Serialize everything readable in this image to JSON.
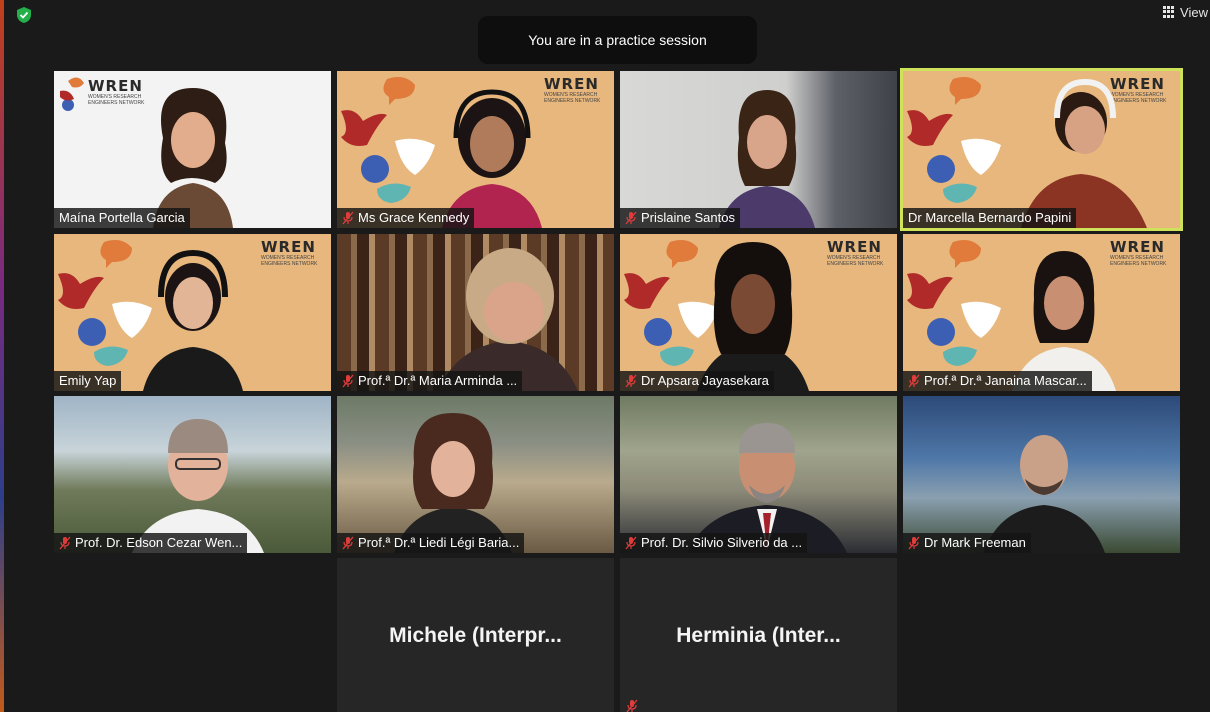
{
  "header": {
    "security_icon": "shield-check-icon",
    "view_label": "View",
    "banner_text": "You are in a practice session"
  },
  "colors": {
    "background": "#1a1a1a",
    "active_speaker_border": "#cfe35a",
    "wren_background": "#e7b77d",
    "muted_icon": "#e03c3c"
  },
  "wren": {
    "word": "WREN",
    "tagline": "WOMEN'S RESEARCH ENGINEERS NETWORK"
  },
  "participants": [
    {
      "name": "Maína Portella Garcia",
      "muted": false
    },
    {
      "name": "Ms Grace Kennedy",
      "muted": true
    },
    {
      "name": "Prislaine Santos",
      "muted": true
    },
    {
      "name": "Dr Marcella Bernardo Papini",
      "muted": false,
      "active_speaker": true
    },
    {
      "name": "Emily Yap",
      "muted": false
    },
    {
      "name": "Prof.ª Dr.ª Maria Arminda ...",
      "muted": true
    },
    {
      "name": "Dr Apsara Jayasekara",
      "muted": true
    },
    {
      "name": "Prof.ª Dr.ª Janaina Mascar...",
      "muted": true
    },
    {
      "name": "Prof. Dr. Edson Cezar Wen...",
      "muted": true
    },
    {
      "name": "Prof.ª Dr.ª Liedi Légi Baria...",
      "muted": true
    },
    {
      "name": "Prof. Dr. Silvio Silverio da ...",
      "muted": true
    },
    {
      "name": "Dr Mark Freeman",
      "muted": true
    },
    {
      "name": "Michele  (Interpr...",
      "muted": false,
      "video_off": true
    },
    {
      "name": "Herminia  (Inter...",
      "muted": true,
      "video_off": true
    }
  ]
}
